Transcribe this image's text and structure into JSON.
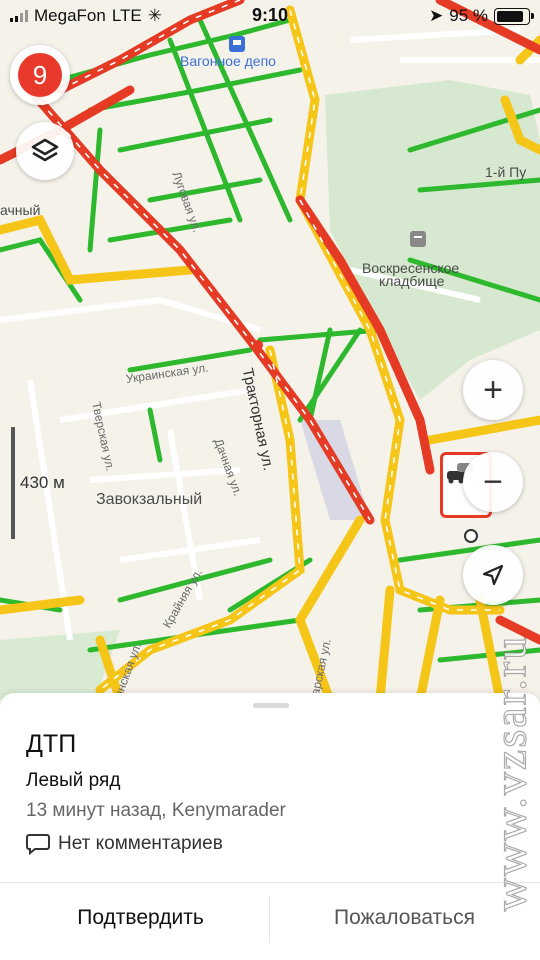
{
  "status_bar": {
    "carrier": "MegaFon",
    "network": "LTE",
    "time": "9:10",
    "battery": "95 %",
    "battery_level_percent": 95
  },
  "map": {
    "labels": {
      "depot": "Вагонное депо",
      "cemetery_line1": "Воскресенское",
      "cemetery_line2": "кладбище",
      "district": "Завокзальный",
      "partial_left": "ачный",
      "partial_right": "1-й Пу"
    },
    "streets": {
      "traktornaya": "Тракторная ул.",
      "ukrainskaya": "Украинская ул.",
      "tverskaya": "Тверская ул.",
      "dachnaya": "Дачная ул.",
      "krainyaya": "Крайняя ул.",
      "lugovaya": "Луговая ул.",
      "bottom_left": "анская ул.",
      "bottom_mid": "арская ул."
    },
    "scale_label": "430 м",
    "notifications_count": "9",
    "colors": {
      "traffic_free": "#2eb82e",
      "traffic_moderate": "#f5c518",
      "traffic_heavy": "#e53a24",
      "badge": "#e8392b"
    },
    "controls": {
      "zoom_in": "+",
      "zoom_out": "−"
    }
  },
  "incident": {
    "title": "ДТП",
    "lane": "Левый ряд",
    "meta": "13 минут назад, Kenymarader",
    "comments": "Нет комментариев",
    "confirm_label": "Подтвердить",
    "report_label": "Пожаловаться"
  },
  "watermark": "www.vzsar.ru"
}
